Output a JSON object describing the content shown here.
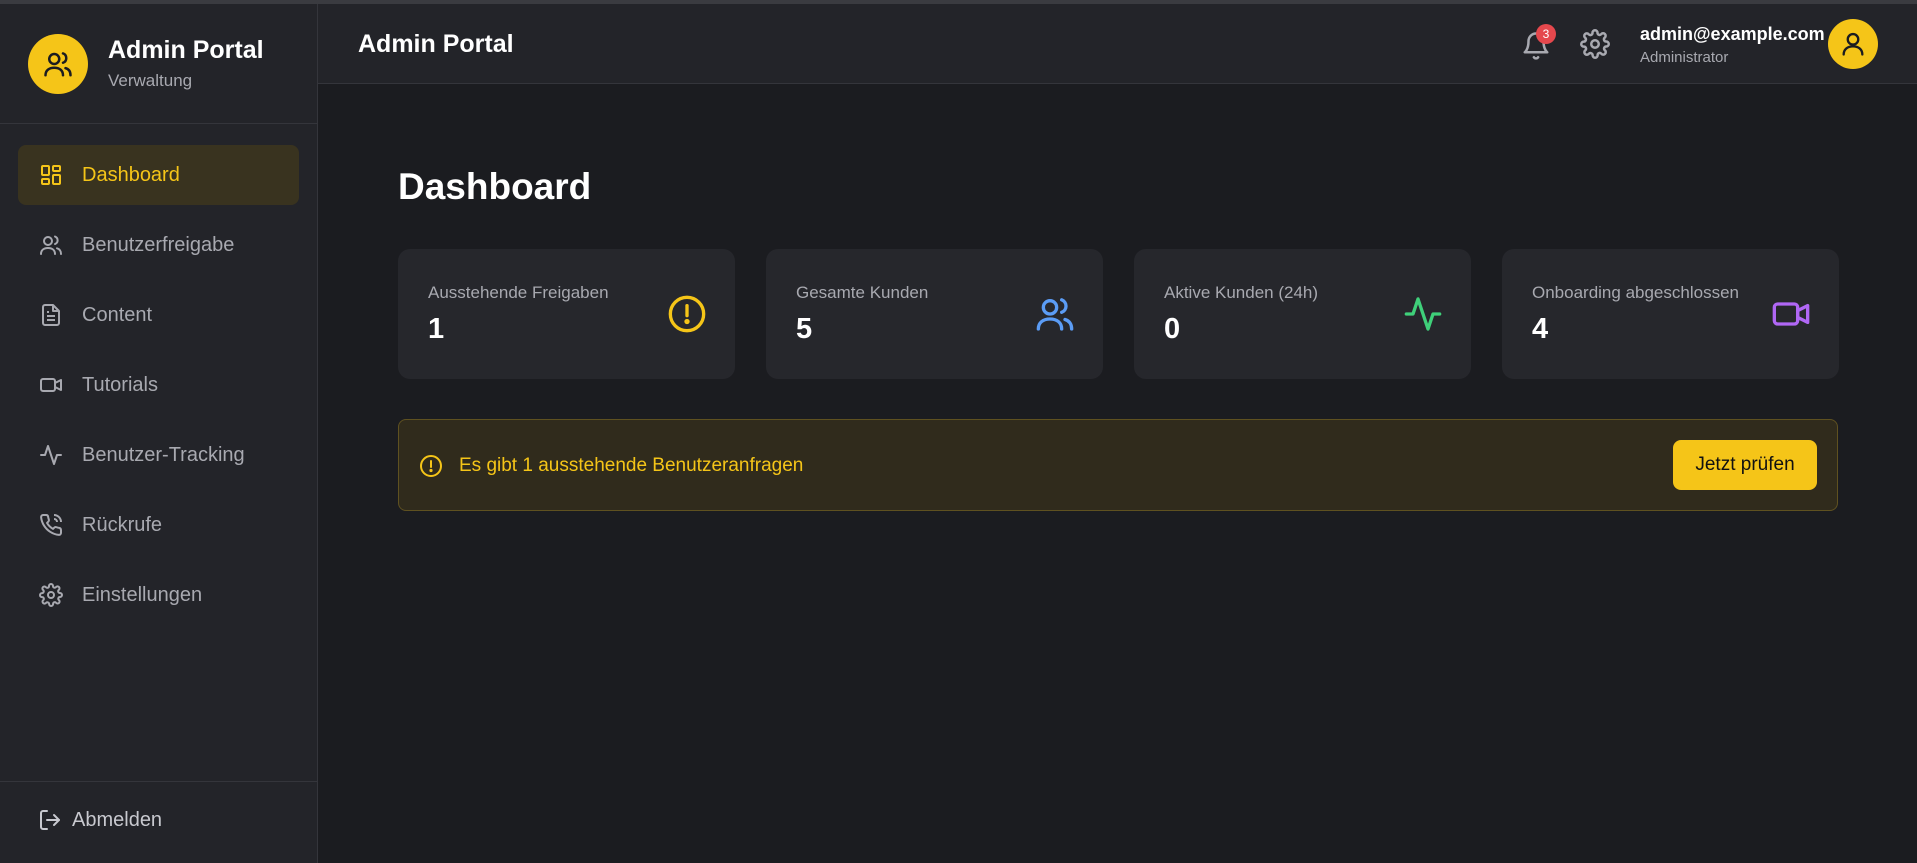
{
  "brand": {
    "title": "Admin Portal",
    "subtitle": "Verwaltung"
  },
  "sidebar": {
    "items": [
      {
        "label": "Dashboard",
        "icon": "dashboard-icon",
        "active": true
      },
      {
        "label": "Benutzerfreigabe",
        "icon": "users-icon"
      },
      {
        "label": "Content",
        "icon": "document-icon"
      },
      {
        "label": "Tutorials",
        "icon": "video-icon"
      },
      {
        "label": "Benutzer-Tracking",
        "icon": "activity-icon"
      },
      {
        "label": "Rückrufe",
        "icon": "phone-icon"
      },
      {
        "label": "Einstellungen",
        "icon": "gear-icon"
      }
    ],
    "logout_label": "Abmelden"
  },
  "topbar": {
    "title": "Admin Portal",
    "notification_count": "3",
    "user_email": "admin@example.com",
    "user_role": "Administrator"
  },
  "main": {
    "title": "Dashboard",
    "cards": [
      {
        "label": "Ausstehende Freigaben",
        "value": "1",
        "icon": "alert-circle-icon",
        "color": "#f5c518"
      },
      {
        "label": "Gesamte Kunden",
        "value": "5",
        "icon": "users-icon",
        "color": "#5b9cf5"
      },
      {
        "label": "Aktive Kunden (24h)",
        "value": "0",
        "icon": "activity-icon",
        "color": "#3fd07a"
      },
      {
        "label": "Onboarding abgeschlossen",
        "value": "4",
        "icon": "video-icon",
        "color": "#b067f5"
      }
    ],
    "alert": {
      "text": "Es gibt 1 ausstehende Benutzeranfragen",
      "button": "Jetzt prüfen"
    }
  },
  "colors": {
    "accent": "#f5c518",
    "background": "#1b1c20",
    "panel": "#232429",
    "badge": "#e5484d"
  }
}
